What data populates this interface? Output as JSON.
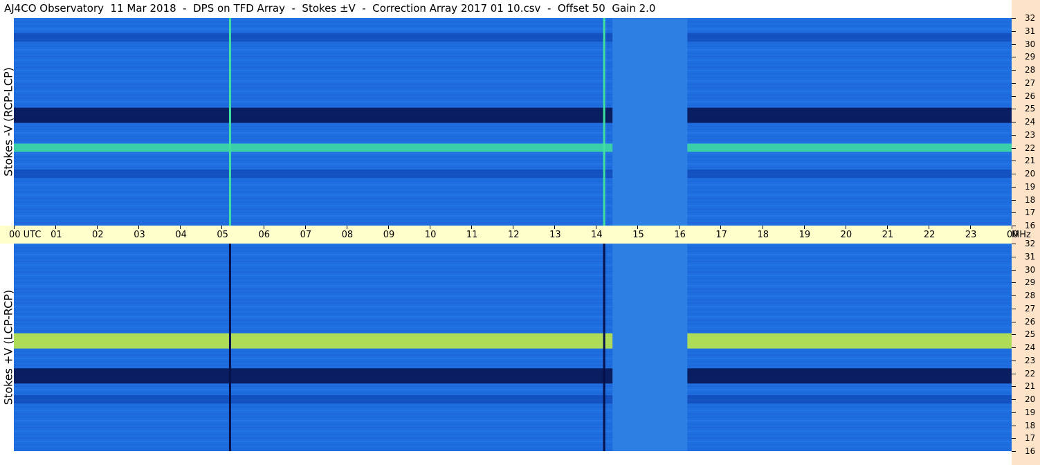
{
  "title": "AJ4CO Observatory  11 Mar 2018  -  DPS on TFD Array  -  Stokes ±V  -  Correction Array 2017 01 10.csv  -  Offset 50  Gain 2.0",
  "panels": [
    {
      "id": "top",
      "ylabel": "Stokes -V (RCP-LCP)"
    },
    {
      "id": "bottom",
      "ylabel": "Stokes +V (LCP-RCP)"
    }
  ],
  "time_axis": {
    "labels": [
      "00  UTC",
      "01",
      "02",
      "03",
      "04",
      "05",
      "06",
      "07",
      "08",
      "09",
      "10",
      "11",
      "12",
      "13",
      "14",
      "15",
      "16",
      "17",
      "18",
      "19",
      "20",
      "21",
      "22",
      "23",
      "00"
    ],
    "unit": "MHz"
  },
  "freq_axis": {
    "labels": [
      "32",
      "31",
      "30",
      "29",
      "28",
      "27",
      "26",
      "25",
      "24",
      "23",
      "22",
      "21",
      "20",
      "19",
      "18",
      "17",
      "16"
    ]
  },
  "colors": {
    "background": "#ffffff",
    "time_axis_bg": "#ffffcc",
    "sidebar_bg": "#fde4c8",
    "base_blue": "#1f6ee0",
    "dark_band": "#06114a",
    "bright_band": "#3fe0a0",
    "yellow_band": "#c8f040"
  },
  "chart_data": [
    {
      "type": "heatmap",
      "title": "Stokes -V (RCP-LCP)",
      "x_range_utc_hours": [
        0,
        24
      ],
      "y_range_mhz": [
        16,
        32
      ],
      "xlabel": "UTC",
      "ylabel": "Stokes -V (RCP-LCP)",
      "horizontal_bands": [
        {
          "mhz": 24.5,
          "level": "very low"
        },
        {
          "mhz": 22.0,
          "level": "high"
        },
        {
          "mhz": 20.0,
          "level": "low"
        },
        {
          "mhz": 30.5,
          "level": "low"
        }
      ],
      "vertical_features": [
        {
          "utc": 5.2,
          "level": "high"
        },
        {
          "utc": 14.2,
          "level": "high"
        }
      ],
      "gap_utc": [
        14.4,
        16.2
      ]
    },
    {
      "type": "heatmap",
      "title": "Stokes +V (LCP-RCP)",
      "x_range_utc_hours": [
        0,
        24
      ],
      "y_range_mhz": [
        16,
        32
      ],
      "xlabel": "UTC",
      "ylabel": "Stokes +V (LCP-RCP)",
      "horizontal_bands": [
        {
          "mhz": 24.5,
          "level": "very high"
        },
        {
          "mhz": 21.8,
          "level": "very low"
        },
        {
          "mhz": 20.0,
          "level": "low"
        }
      ],
      "vertical_features": [
        {
          "utc": 5.2,
          "level": "very low"
        },
        {
          "utc": 14.2,
          "level": "very low"
        }
      ],
      "gap_utc": [
        14.4,
        16.2
      ]
    }
  ]
}
